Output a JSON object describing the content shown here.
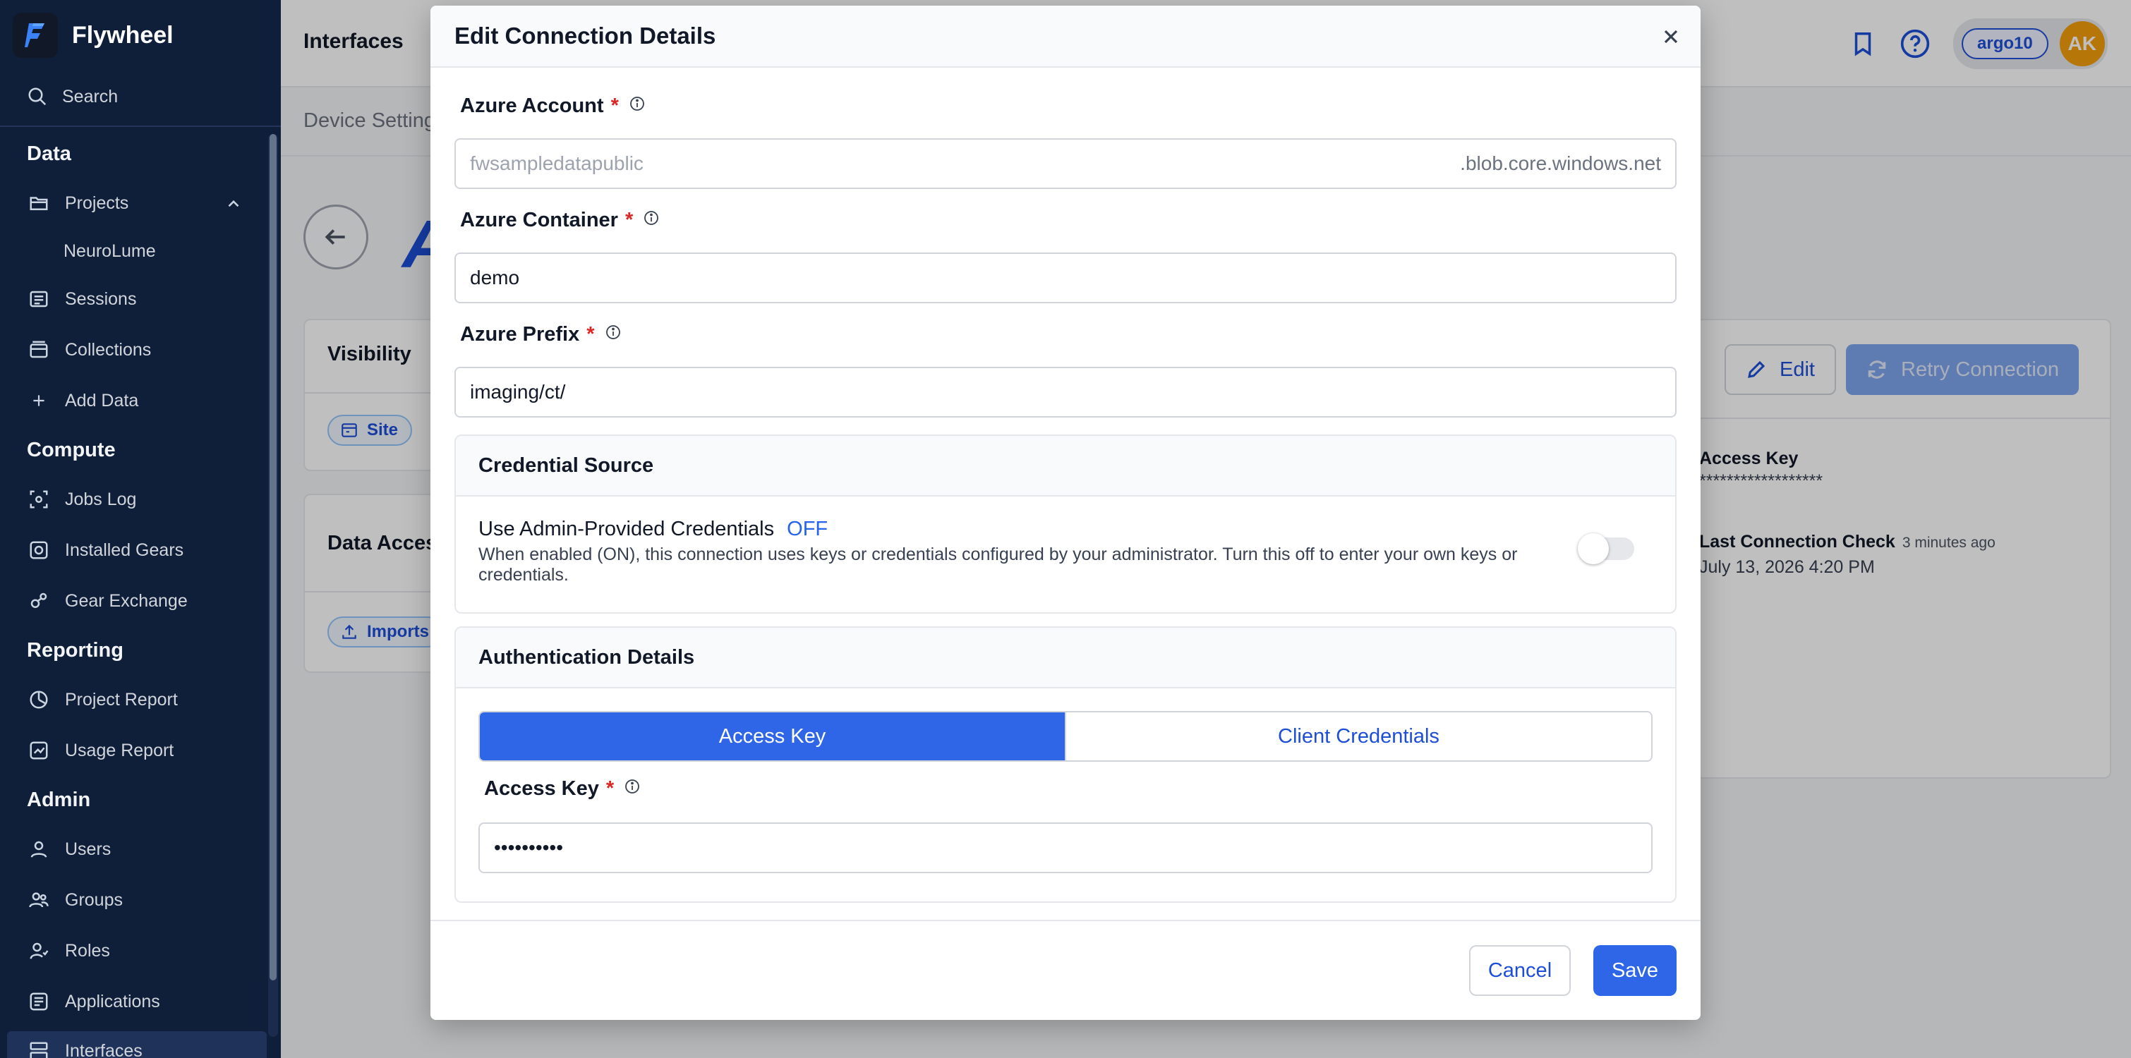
{
  "app": {
    "name": "Flywheel",
    "page_title": "Interfaces"
  },
  "sidebar": {
    "search_label": "Search",
    "sections": {
      "data": "Data",
      "compute": "Compute",
      "reporting": "Reporting",
      "admin": "Admin"
    },
    "items": {
      "projects": "Projects",
      "neurolume": "NeuroLume",
      "sessions": "Sessions",
      "collections": "Collections",
      "add_data": "Add Data",
      "jobs_log": "Jobs Log",
      "installed_gears": "Installed Gears",
      "gear_exchange": "Gear Exchange",
      "project_report": "Project Report",
      "usage_report": "Usage Report",
      "users": "Users",
      "groups": "Groups",
      "roles": "Roles",
      "applications": "Applications",
      "interfaces": "Interfaces"
    }
  },
  "header": {
    "site_chip": "argo10",
    "avatar_initials": "AK"
  },
  "background": {
    "subbar_text": "Device Setting",
    "visibility_title": "Visibility",
    "site_chip": "Site",
    "data_access_title": "Data Acces",
    "imports_chip": "Imports",
    "edit_label": "Edit",
    "retry_label": "Retry Connection",
    "access_key_label": "Access Key",
    "access_key_value": "******************",
    "last_check_label": "Last Connection Check",
    "last_check_relative": "3 minutes ago",
    "last_check_value": "July 13, 2026 4:20 PM"
  },
  "modal": {
    "title": "Edit Connection Details",
    "required_mark": "*",
    "azure_account": {
      "label": "Azure Account",
      "placeholder": "fwsampledatapublic",
      "suffix": ".blob.core.windows.net"
    },
    "azure_container": {
      "label": "Azure Container",
      "value": "demo"
    },
    "azure_prefix": {
      "label": "Azure Prefix",
      "value": "imaging/ct/"
    },
    "credential_source": {
      "title": "Credential Source",
      "toggle_label": "Use Admin-Provided Credentials",
      "toggle_state": "OFF",
      "description": "When enabled (ON), this connection uses keys or credentials configured by your administrator. Turn this off to enter your own keys or credentials."
    },
    "authentication": {
      "title": "Authentication Details",
      "tabs": [
        "Access Key",
        "Client Credentials"
      ],
      "access_key_label": "Access Key",
      "access_key_value": "••••••••••"
    },
    "cancel_label": "Cancel",
    "save_label": "Save"
  }
}
